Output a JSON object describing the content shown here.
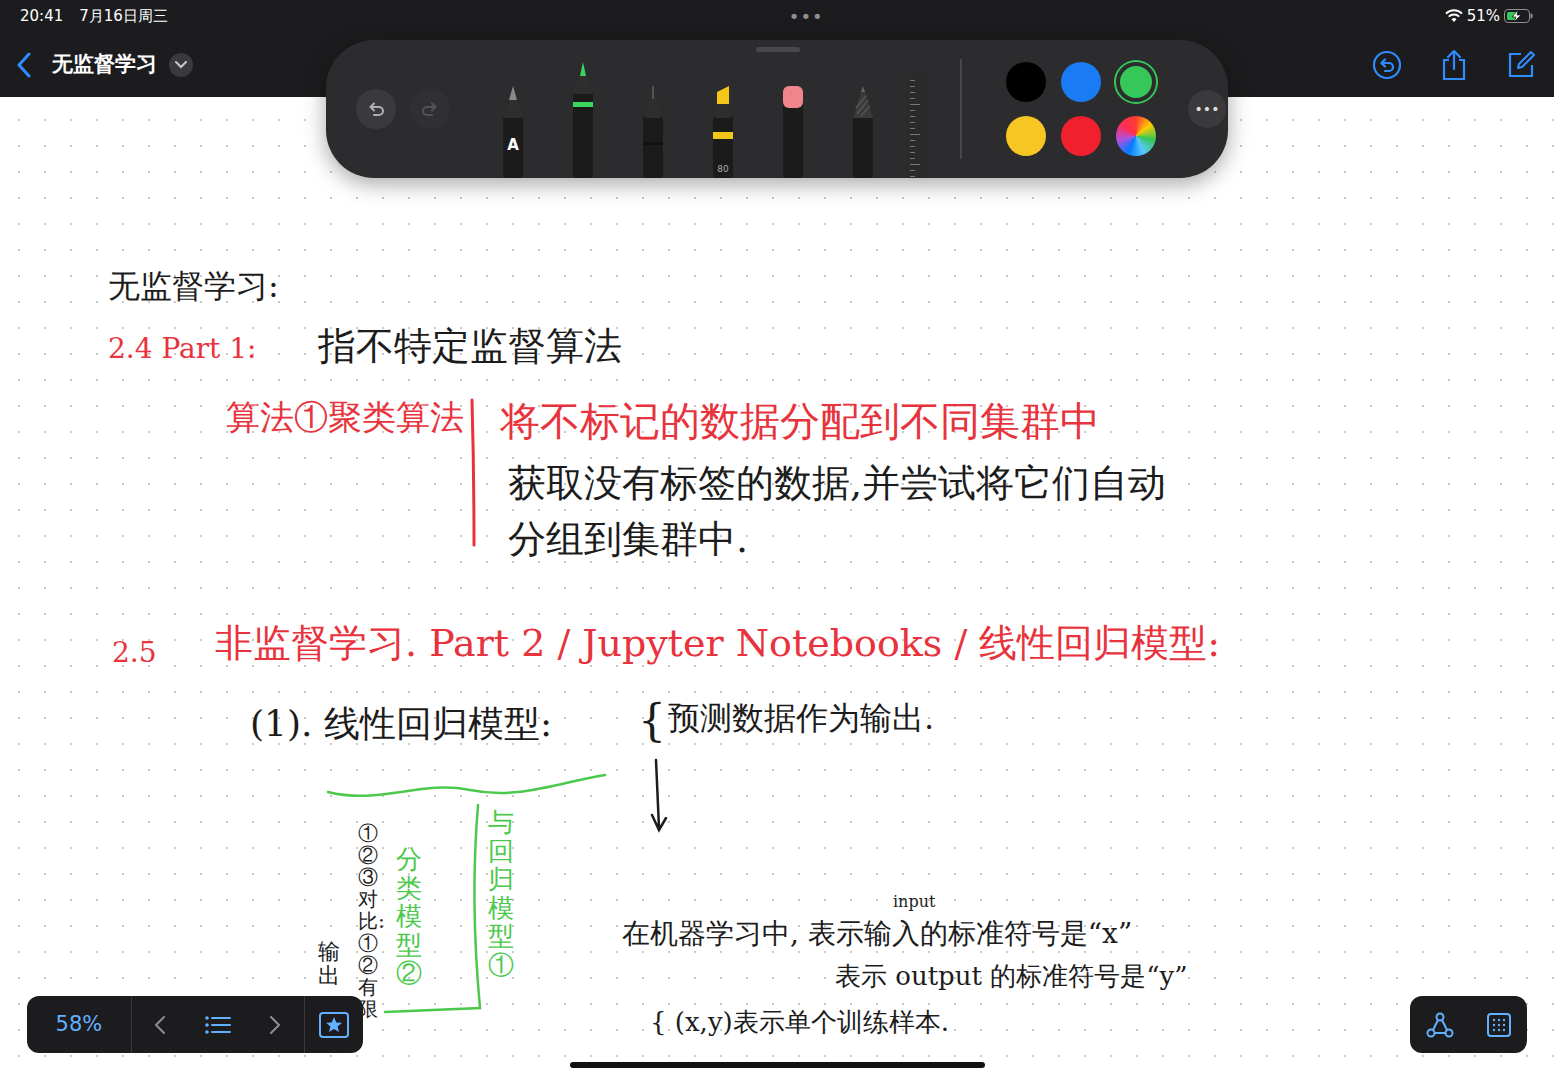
{
  "status_bar": {
    "time": "20:41",
    "date": "7月16日周三",
    "battery": "51%",
    "battery_level": 0.51,
    "charging": true
  },
  "top_dots": "•••",
  "nav": {
    "title": "无监督学习"
  },
  "toolbar": {
    "undo": {
      "disabled": false
    },
    "redo": {
      "disabled": true
    },
    "tools": [
      {
        "kind": "marker",
        "label": "A",
        "selected": false
      },
      {
        "kind": "fountain",
        "selected": true,
        "color": "#3ad65e"
      },
      {
        "kind": "fineliner",
        "selected": false,
        "color": "#111111"
      },
      {
        "kind": "highlighter",
        "label": "80",
        "selected": false,
        "color": "#f5c518"
      },
      {
        "kind": "eraser",
        "selected": false,
        "color": "#f0868c"
      },
      {
        "kind": "pencil",
        "selected": false
      },
      {
        "kind": "ruler",
        "selected": false
      }
    ],
    "colors": [
      {
        "kind": "swatch",
        "color": "#000000",
        "selected": false
      },
      {
        "kind": "swatch",
        "color": "#1a7cf5",
        "selected": false
      },
      {
        "kind": "swatch",
        "color": "#35c759",
        "selected": true
      },
      {
        "kind": "swatch",
        "color": "#f7c623",
        "selected": false
      },
      {
        "kind": "swatch",
        "color": "#f0202c",
        "selected": false
      },
      {
        "kind": "picker",
        "selected": false
      }
    ],
    "more": "•••"
  },
  "notes": [
    {
      "kind": "text",
      "text": "无监督学习:",
      "color": "#1c1c1c"
    },
    {
      "kind": "text",
      "text": "2.4 Part 1:",
      "color": "#e8323c"
    },
    {
      "kind": "text",
      "text": "指不特定监督算法",
      "color": "#1c1c1c"
    },
    {
      "kind": "text",
      "text": "算法①聚类算法",
      "color": "#e8323c"
    },
    {
      "kind": "text",
      "text": "将不标记的数据分配到不同集群中",
      "color": "#e8323c"
    },
    {
      "kind": "text",
      "text": "获取没有标签的数据,并尝试将它们自动",
      "color": "#1c1c1c"
    },
    {
      "kind": "text",
      "text": "分组到集群中.",
      "color": "#1c1c1c"
    },
    {
      "kind": "text",
      "text": "2.5",
      "color": "#e8323c"
    },
    {
      "kind": "text",
      "text": "非监督学习. Part 2 / Jupyter Notebooks / 线性回归模型:",
      "color": "#e8323c"
    },
    {
      "kind": "text",
      "text": "(1). 线性回归模型:",
      "color": "#1c1c1c"
    },
    {
      "kind": "text",
      "text": "{",
      "color": "#1c1c1c"
    },
    {
      "kind": "text",
      "text": "预测数据作为输出.",
      "color": "#1c1c1c"
    },
    {
      "kind": "vertical",
      "text": "①②③对比:①②有限",
      "color": "#1c1c1c"
    },
    {
      "kind": "vertical",
      "text": "输出",
      "color": "#1c1c1c"
    },
    {
      "kind": "vertical",
      "text": "分类模型②",
      "color": "#4cc94c"
    },
    {
      "kind": "vertical",
      "text": "与回归模型①",
      "color": "#4cc94c"
    },
    {
      "kind": "text",
      "text": "在机器学习中, 表示输入的标准符号是“x”",
      "color": "#1c1c1c"
    },
    {
      "kind": "text",
      "text": "input",
      "color": "#1c1c1c"
    },
    {
      "kind": "text",
      "text": "表示 output 的标准符号是“y”",
      "color": "#1c1c1c"
    },
    {
      "kind": "text",
      "text": "{ (x,y)表示单个训练样本.",
      "color": "#1c1c1c"
    }
  ],
  "zoom": {
    "label": "58%"
  }
}
